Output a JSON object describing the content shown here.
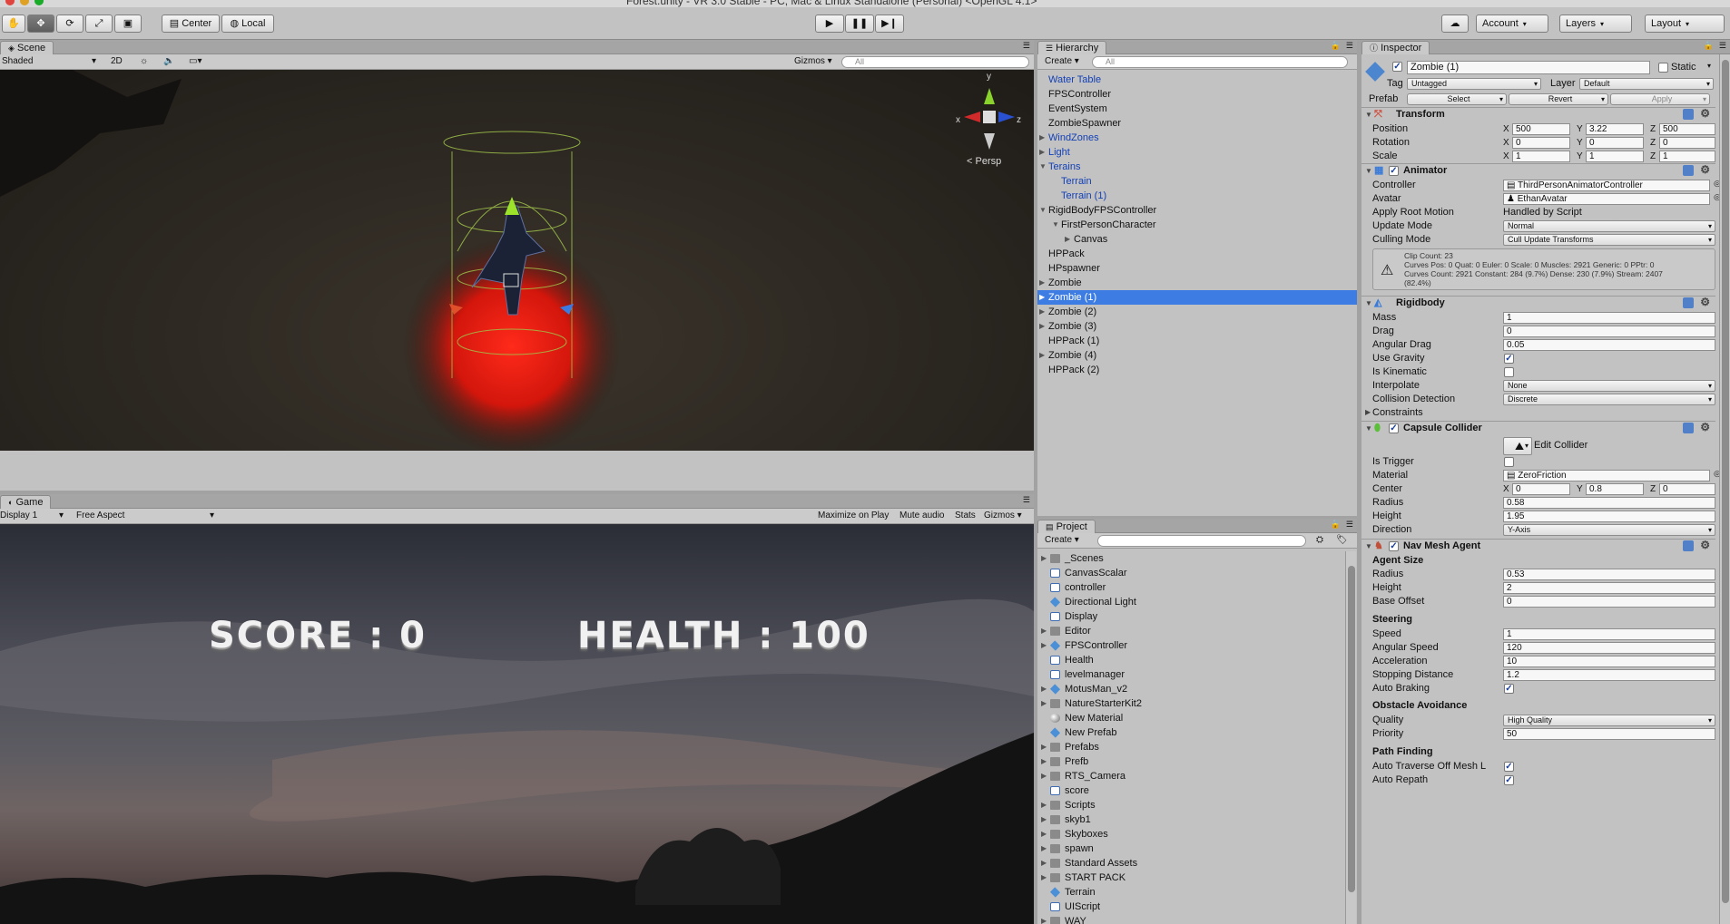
{
  "window": {
    "title": "Forest.unity - VR 3.0 Stable - PC, Mac & Linux Standalone (Personal) <OpenGL 4.1>"
  },
  "toolbar": {
    "pivot_mode": "Center",
    "pivot_space": "Local",
    "account": "Account",
    "layers": "Layers",
    "layout": "Layout"
  },
  "scene": {
    "tab": "Scene",
    "shading": "Shaded",
    "mode_2d": "2D",
    "gizmos": "Gizmos",
    "search_placeholder": "All",
    "persp_label": "Persp",
    "gizmo_axes": {
      "x": "x",
      "y": "y",
      "z": "z"
    }
  },
  "game": {
    "tab": "Game",
    "display": "Display 1",
    "aspect": "Free Aspect",
    "maximize": "Maximize on Play",
    "mute": "Mute audio",
    "stats": "Stats",
    "gizmos": "Gizmos",
    "score_text": "SCORE : 0",
    "health_text": "HEALTH : 100"
  },
  "hierarchy": {
    "tab": "Hierarchy",
    "create": "Create",
    "search_placeholder": "All",
    "items": [
      {
        "label": "Water Table",
        "style": "blue",
        "fold": ""
      },
      {
        "label": "FPSController",
        "style": "",
        "fold": ""
      },
      {
        "label": "EventSystem",
        "style": "",
        "fold": ""
      },
      {
        "label": "ZombieSpawner",
        "style": "",
        "fold": ""
      },
      {
        "label": "WindZones",
        "style": "blue",
        "fold": "▶"
      },
      {
        "label": "Light",
        "style": "blue",
        "fold": "▶"
      },
      {
        "label": "Terains",
        "style": "blue",
        "fold": "▼"
      },
      {
        "label": "Terrain",
        "style": "blue",
        "fold": ""
      },
      {
        "label": "Terrain (1)",
        "style": "blue",
        "fold": ""
      },
      {
        "label": "RigidBodyFPSController",
        "style": "",
        "fold": "▼"
      },
      {
        "label": "FirstPersonCharacter",
        "style": "",
        "fold": "▼"
      },
      {
        "label": "Canvas",
        "style": "",
        "fold": "▶"
      },
      {
        "label": "HPPack",
        "style": "",
        "fold": ""
      },
      {
        "label": "HPspawner",
        "style": "",
        "fold": ""
      },
      {
        "label": "Zombie",
        "style": "",
        "fold": "▶"
      },
      {
        "label": "Zombie (1)",
        "style": "selected",
        "fold": "▶"
      },
      {
        "label": "Zombie (2)",
        "style": "",
        "fold": "▶"
      },
      {
        "label": "Zombie (3)",
        "style": "",
        "fold": "▶"
      },
      {
        "label": "HPPack (1)",
        "style": "",
        "fold": ""
      },
      {
        "label": "Zombie (4)",
        "style": "",
        "fold": "▶"
      },
      {
        "label": "HPPack (2)",
        "style": "",
        "fold": ""
      }
    ]
  },
  "project": {
    "tab": "Project",
    "create": "Create",
    "items": [
      {
        "label": "_Scenes",
        "icon": "folder",
        "fold": "▶"
      },
      {
        "label": "CanvasScalar",
        "icon": "script",
        "fold": ""
      },
      {
        "label": "controller",
        "icon": "script",
        "fold": ""
      },
      {
        "label": "Directional Light",
        "icon": "prefab",
        "fold": ""
      },
      {
        "label": "Display",
        "icon": "script",
        "fold": ""
      },
      {
        "label": "Editor",
        "icon": "folder",
        "fold": "▶"
      },
      {
        "label": "FPSController",
        "icon": "prefab",
        "fold": "▶"
      },
      {
        "label": "Health",
        "icon": "script",
        "fold": ""
      },
      {
        "label": "levelmanager",
        "icon": "script",
        "fold": ""
      },
      {
        "label": "MotusMan_v2",
        "icon": "prefab",
        "fold": "▶"
      },
      {
        "label": "NatureStarterKit2",
        "icon": "folder",
        "fold": "▶"
      },
      {
        "label": "New Material",
        "icon": "material",
        "fold": ""
      },
      {
        "label": "New Prefab",
        "icon": "prefab",
        "fold": ""
      },
      {
        "label": "Prefabs",
        "icon": "folder",
        "fold": "▶"
      },
      {
        "label": "Prefb",
        "icon": "folder",
        "fold": "▶"
      },
      {
        "label": "RTS_Camera",
        "icon": "folder",
        "fold": "▶"
      },
      {
        "label": "score",
        "icon": "script",
        "fold": ""
      },
      {
        "label": "Scripts",
        "icon": "folder",
        "fold": "▶"
      },
      {
        "label": "skyb1",
        "icon": "folder",
        "fold": "▶"
      },
      {
        "label": "Skyboxes",
        "icon": "folder",
        "fold": "▶"
      },
      {
        "label": "spawn",
        "icon": "folder",
        "fold": "▶"
      },
      {
        "label": "Standard Assets",
        "icon": "folder",
        "fold": "▶"
      },
      {
        "label": "START PACK",
        "icon": "folder",
        "fold": "▶"
      },
      {
        "label": "Terrain",
        "icon": "prefab",
        "fold": ""
      },
      {
        "label": "UIScript",
        "icon": "script",
        "fold": ""
      },
      {
        "label": "WAY",
        "icon": "folder",
        "fold": "▶"
      }
    ]
  },
  "inspector": {
    "tab": "Inspector",
    "object_name": "Zombie (1)",
    "static_label": "Static",
    "tag_label": "Tag",
    "tag_value": "Untagged",
    "layer_label": "Layer",
    "layer_value": "Default",
    "prefab_label": "Prefab",
    "prefab_select": "Select",
    "prefab_revert": "Revert",
    "prefab_apply": "Apply",
    "transform": {
      "title": "Transform",
      "rows": [
        {
          "label": "Position",
          "x": "500",
          "y": "3.22",
          "z": "500"
        },
        {
          "label": "Rotation",
          "x": "0",
          "y": "0",
          "z": "0"
        },
        {
          "label": "Scale",
          "x": "1",
          "y": "1",
          "z": "1"
        }
      ]
    },
    "animator": {
      "title": "Animator",
      "controller_label": "Controller",
      "controller_value": "ThirdPersonAnimatorController",
      "avatar_label": "Avatar",
      "avatar_value": "EthanAvatar",
      "root_motion_label": "Apply Root Motion",
      "root_motion_value": "Handled by Script",
      "update_mode_label": "Update Mode",
      "update_mode_value": "Normal",
      "culling_label": "Culling Mode",
      "culling_value": "Cull Update Transforms",
      "info_line1": "Clip Count: 23",
      "info_line2": "Curves Pos: 0 Quat: 0 Euler: 0 Scale: 0 Muscles: 2921 Generic: 0 PPtr: 0",
      "info_line3": "Curves Count: 2921 Constant: 284 (9.7%) Dense: 230 (7.9%) Stream: 2407",
      "info_line4": "(82.4%)"
    },
    "rigidbody": {
      "title": "Rigidbody",
      "mass_label": "Mass",
      "mass": "1",
      "drag_label": "Drag",
      "drag": "0",
      "angular_drag_label": "Angular Drag",
      "angular_drag": "0.05",
      "use_gravity_label": "Use Gravity",
      "is_kinematic_label": "Is Kinematic",
      "interpolate_label": "Interpolate",
      "interpolate": "None",
      "collision_label": "Collision Detection",
      "collision": "Discrete",
      "constraints_label": "Constraints"
    },
    "capsule": {
      "title": "Capsule Collider",
      "edit_collider": "Edit Collider",
      "is_trigger_label": "Is Trigger",
      "material_label": "Material",
      "material": "ZeroFriction",
      "center_label": "Center",
      "cx": "0",
      "cy": "0.8",
      "cz": "0",
      "radius_label": "Radius",
      "radius": "0.58",
      "height_label": "Height",
      "height": "1.95",
      "direction_label": "Direction",
      "direction": "Y-Axis"
    },
    "navmesh": {
      "title": "Nav Mesh Agent",
      "agent_size": "Agent Size",
      "radius_label": "Radius",
      "radius": "0.53",
      "height_label": "Height",
      "height": "2",
      "base_offset_label": "Base Offset",
      "base_offset": "0",
      "steering": "Steering",
      "speed_label": "Speed",
      "speed": "1",
      "ang_speed_label": "Angular Speed",
      "ang_speed": "120",
      "accel_label": "Acceleration",
      "accel": "10",
      "stop_label": "Stopping Distance",
      "stop": "1.2",
      "auto_brake_label": "Auto Braking",
      "obstacle": "Obstacle Avoidance",
      "quality_label": "Quality",
      "quality": "High Quality",
      "priority_label": "Priority",
      "priority": "50",
      "path_finding": "Path Finding",
      "auto_traverse_label": "Auto Traverse Off Mesh L",
      "auto_repath_label": "Auto Repath"
    }
  }
}
